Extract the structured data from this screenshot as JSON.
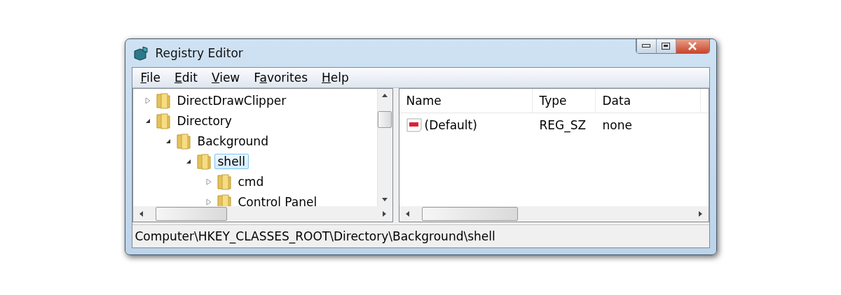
{
  "window": {
    "title": "Registry Editor"
  },
  "menu": [
    {
      "key": "F",
      "rest": "ile"
    },
    {
      "key": "E",
      "rest": "dit"
    },
    {
      "key": "V",
      "rest": "iew"
    },
    {
      "lead": "F",
      "key": "a",
      "rest": "vorites"
    },
    {
      "key": "H",
      "rest": "elp"
    }
  ],
  "tree": [
    {
      "label": "DirectDrawClipper",
      "expanded": false,
      "selected": false
    },
    {
      "label": "Directory",
      "expanded": true,
      "selected": false,
      "children": [
        {
          "label": "Background",
          "expanded": true,
          "selected": false,
          "children": [
            {
              "label": "shell",
              "expanded": true,
              "selected": true,
              "children": [
                {
                  "label": "cmd",
                  "expanded": false,
                  "selected": false
                },
                {
                  "label": "Control Panel",
                  "expanded": false,
                  "selected": false
                }
              ]
            }
          ]
        }
      ]
    }
  ],
  "values": {
    "columns": [
      "Name",
      "Type",
      "Data"
    ],
    "rows": [
      {
        "name": "(Default)",
        "type": "REG_SZ",
        "data": "none"
      }
    ]
  },
  "status_bar": "Computer\\HKEY_CLASSES_ROOT\\Directory\\Background\\shell"
}
